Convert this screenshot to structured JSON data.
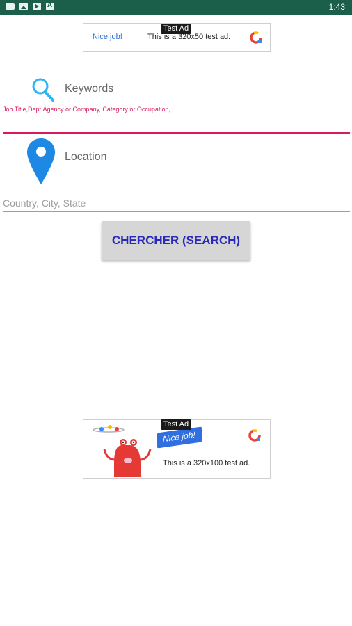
{
  "status_bar": {
    "time": "1:43"
  },
  "top_ad": {
    "label": "Test Ad",
    "headline": "Nice job!",
    "message": "This is a 320x50 test ad."
  },
  "keywords": {
    "title": "Keywords",
    "hint": "Job Title,Dept,Agency or Company, Category or Occupation,"
  },
  "location": {
    "title": "Location",
    "placeholder": "Country, City, State",
    "value": ""
  },
  "search_button": {
    "label": "CHERCHER (SEARCH)"
  },
  "bottom_ad": {
    "label": "Test Ad",
    "headline": "Nice job!",
    "message": "This is a 320x100 test ad."
  },
  "colors": {
    "status_bar": "#1b5e4a",
    "accent": "#d81b60",
    "search_icon": "#29b6f6",
    "pin_icon": "#1e88e5",
    "button_text": "#2a2ab8"
  },
  "icons": [
    "keyboard-icon",
    "image-icon",
    "youtube-icon",
    "a-badge-icon",
    "search-icon",
    "location-pin-icon",
    "ad-logo-icon"
  ]
}
